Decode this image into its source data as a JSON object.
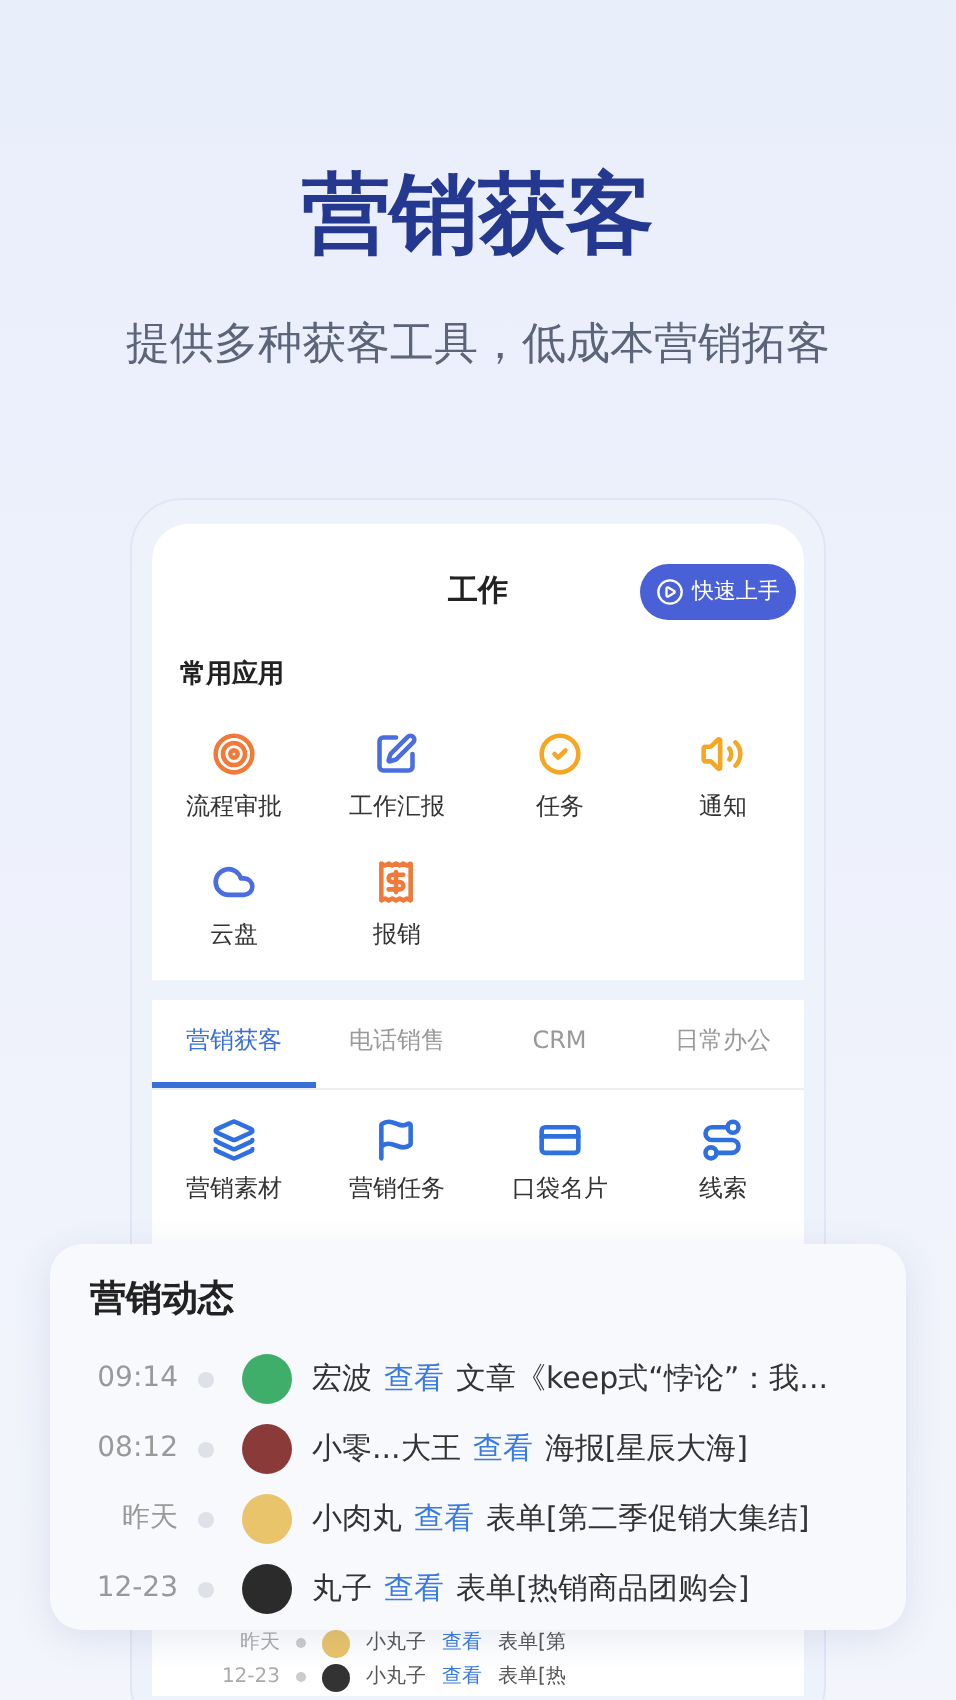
{
  "headline": "营销获客",
  "subtitle": "提供多种获客工具，低成本营销拓客",
  "phone": {
    "title": "工作",
    "quick_start_button": "快速上手",
    "common_apps": {
      "title": "常用应用",
      "items": [
        {
          "label": "流程审批"
        },
        {
          "label": "工作汇报"
        },
        {
          "label": "任务"
        },
        {
          "label": "通知"
        },
        {
          "label": "云盘"
        },
        {
          "label": "报销"
        }
      ]
    },
    "tabs": [
      {
        "label": "营销获客",
        "selected": true
      },
      {
        "label": "电话销售",
        "selected": false
      },
      {
        "label": "CRM",
        "selected": false
      },
      {
        "label": "日常办公",
        "selected": false
      }
    ],
    "tab_apps": [
      {
        "label": "营销素材"
      },
      {
        "label": "营销任务"
      },
      {
        "label": "口袋名片"
      },
      {
        "label": "线索"
      }
    ],
    "faded_rows": [
      {
        "time": "昨天",
        "name": "小丸子",
        "action": "查看",
        "target": "表单[第",
        "color": "#e9c46a"
      },
      {
        "time": "12-23",
        "name": "小丸子",
        "action": "查看",
        "target": "表单[热",
        "color": "#333333"
      }
    ]
  },
  "activity": {
    "title": "营销动态",
    "items": [
      {
        "time": "09:14",
        "name": "宏波",
        "action": "查看",
        "target": "文章《keep式“悖论”：我...",
        "color": "#3fae6a"
      },
      {
        "time": "08:12",
        "name": "小零...大王",
        "action": "查看",
        "target": "海报[星辰大海]",
        "color": "#8b3a3a"
      },
      {
        "time": "昨天",
        "name": "小肉丸",
        "action": "查看",
        "target": "表单[第二季促销大集结]",
        "color": "#e9c46a"
      },
      {
        "time": "12-23",
        "name": "丸子",
        "action": "查看",
        "target": "表单[热销商品团购会]",
        "color": "#2b2b2b"
      }
    ]
  }
}
